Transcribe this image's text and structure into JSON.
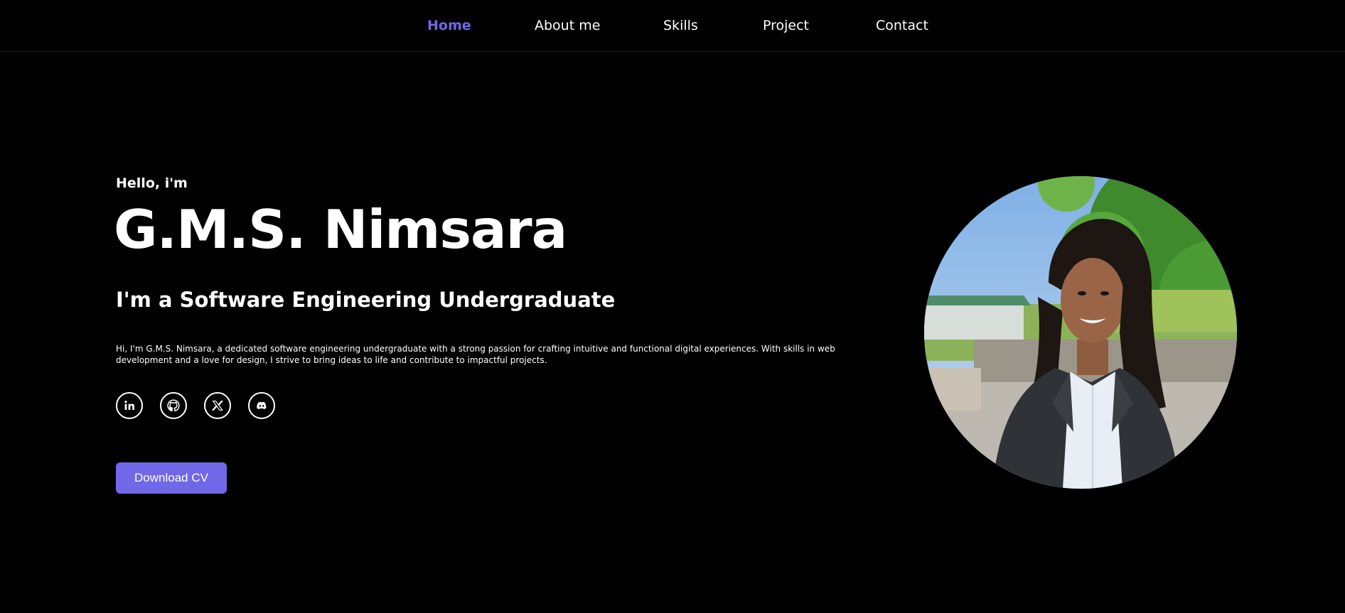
{
  "nav": {
    "items": [
      {
        "label": "Home",
        "active": true
      },
      {
        "label": "About me",
        "active": false
      },
      {
        "label": "Skills",
        "active": false
      },
      {
        "label": "Project",
        "active": false
      },
      {
        "label": "Contact",
        "active": false
      }
    ]
  },
  "hero": {
    "greeting": "Hello, i'm",
    "name": "G.M.S. Nimsara",
    "role": "I'm a Software Engineering Undergraduate",
    "bio": "Hi, I'm G.M.S. Nimsara, a dedicated software engineering undergraduate with a strong passion for crafting intuitive and functional digital experiences. With skills in web development and a love for design, I strive to bring ideas to life and contribute to impactful projects.",
    "socials": [
      {
        "icon": "linkedin-icon"
      },
      {
        "icon": "github-icon"
      },
      {
        "icon": "x-twitter-icon"
      },
      {
        "icon": "discord-icon"
      }
    ],
    "cv_button": "Download CV",
    "photo": "profile-photo"
  },
  "colors": {
    "background": "#000000",
    "accent": "#7068e6",
    "text": "#ffffff"
  }
}
